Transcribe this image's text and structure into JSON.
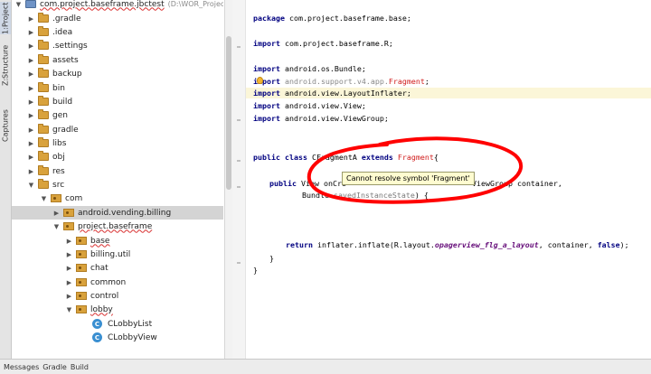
{
  "tool_tabs": [
    {
      "number": "1:",
      "label": "Project"
    },
    {
      "number": "Z:",
      "label": "Structure"
    },
    {
      "label": "Captures"
    }
  ],
  "tree": {
    "root": {
      "label": "com.project.baseframe.jbctest",
      "path": "(D:\\WOR_Project\\wba"
    },
    "items": [
      {
        "label": ".gradle",
        "icon": "folder-icon"
      },
      {
        "label": ".idea",
        "icon": "folder-icon"
      },
      {
        "label": ".settings",
        "icon": "folder-icon"
      },
      {
        "label": "assets",
        "icon": "folder-icon"
      },
      {
        "label": "backup",
        "icon": "folder-icon"
      },
      {
        "label": "bin",
        "icon": "folder-icon"
      },
      {
        "label": "build",
        "icon": "folder-icon"
      },
      {
        "label": "gen",
        "icon": "folder-icon"
      },
      {
        "label": "gradle",
        "icon": "folder-icon"
      },
      {
        "label": "libs",
        "icon": "folder-icon"
      },
      {
        "label": "obj",
        "icon": "folder-icon"
      },
      {
        "label": "res",
        "icon": "folder-icon"
      },
      {
        "label": "src",
        "icon": "folder-icon"
      },
      {
        "label": "com",
        "icon": "package-icon"
      },
      {
        "label": "android.vending.billing",
        "icon": "package-icon"
      },
      {
        "label": "project.baseframe",
        "icon": "package-icon"
      },
      {
        "label": "base",
        "icon": "package-icon"
      },
      {
        "label": "billing.util",
        "icon": "package-icon"
      },
      {
        "label": "chat",
        "icon": "package-icon"
      },
      {
        "label": "common",
        "icon": "package-icon"
      },
      {
        "label": "control",
        "icon": "package-icon"
      },
      {
        "label": "lobby",
        "icon": "package-icon"
      },
      {
        "label": "CLobbyList",
        "icon": "class-icon",
        "icon_text": "C"
      },
      {
        "label": "CLobbyView",
        "icon": "class-icon",
        "icon_text": "C"
      }
    ]
  },
  "code": {
    "package_line": {
      "kw": "package",
      "rest": " com.project.baseframe.base;"
    },
    "import1": {
      "kw": "import",
      "rest": " com.project.baseframe.R;"
    },
    "import2": {
      "kw": "import",
      "rest": " android.os.Bundle;"
    },
    "import3": {
      "kw": "import",
      "rest": " android.support.v4.app.",
      "err": "Fragment",
      "end": ";"
    },
    "import4": {
      "kw": "import",
      "rest": " android.view.LayoutInflater;"
    },
    "import5": {
      "kw": "import",
      "rest": " android.view.View;"
    },
    "import6": {
      "kw": "import",
      "rest": " android.view.ViewGroup;"
    },
    "class_decl": {
      "kw1": "public class",
      "name": " CFragmentA ",
      "kw2": "extends",
      "sp": " ",
      "err": "Fragment",
      "end": "{"
    },
    "method_decl": {
      "kw": "public",
      "rest": " View onCre",
      "tail": "ViewGroup container,"
    },
    "method_decl2": {
      "rest": "Bundle ",
      "param": "savedInstanceState",
      "end": ") {"
    },
    "return_line": {
      "kw": "return",
      "rest": " inflater.inflate(R.layout.",
      "italic": "opagerview_flg_a_layout",
      "mid": ", container, ",
      "kw2": "false",
      "end": ");"
    },
    "close1": "}",
    "close2": "}"
  },
  "tooltip": {
    "text": "Cannot resolve symbol 'Fragment'"
  },
  "status_bar": {
    "items": [
      "Messages",
      "Gradle",
      "Build"
    ]
  },
  "colors": {
    "error": "#d01b1b",
    "annotation": "#ff0000",
    "keyword": "#000080",
    "tooltip_bg": "#fffcd0"
  }
}
